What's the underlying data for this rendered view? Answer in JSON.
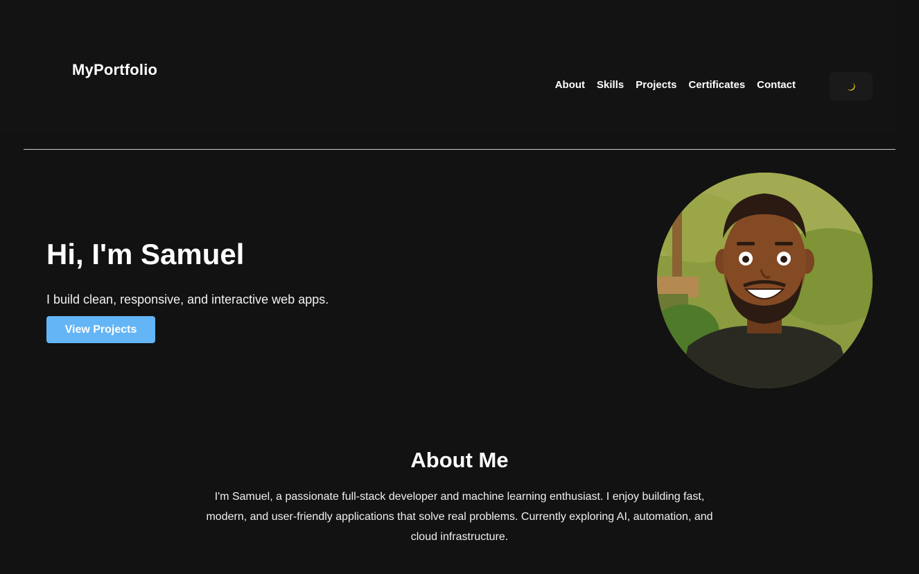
{
  "header": {
    "logo": "MyPortfolio",
    "nav": [
      {
        "label": "About"
      },
      {
        "label": "Skills"
      },
      {
        "label": "Projects"
      },
      {
        "label": "Certificates"
      },
      {
        "label": "Contact"
      }
    ],
    "theme_toggle_icon": "moon-icon"
  },
  "hero": {
    "title": "Hi, I'm Samuel",
    "subtitle": "I build clean, responsive, and interactive web apps.",
    "button_label": "View Projects",
    "avatar": "cartoon-portrait"
  },
  "about": {
    "title": "About Me",
    "text": "I'm Samuel, a passionate full-stack developer and machine learning enthusiast. I enjoy building fast, modern, and user-friendly applications that solve real problems. Currently exploring AI, automation, and cloud infrastructure."
  },
  "colors": {
    "background": "#121212",
    "accent": "#64b5f6",
    "text": "#ffffff",
    "moon": "#f5c518"
  }
}
